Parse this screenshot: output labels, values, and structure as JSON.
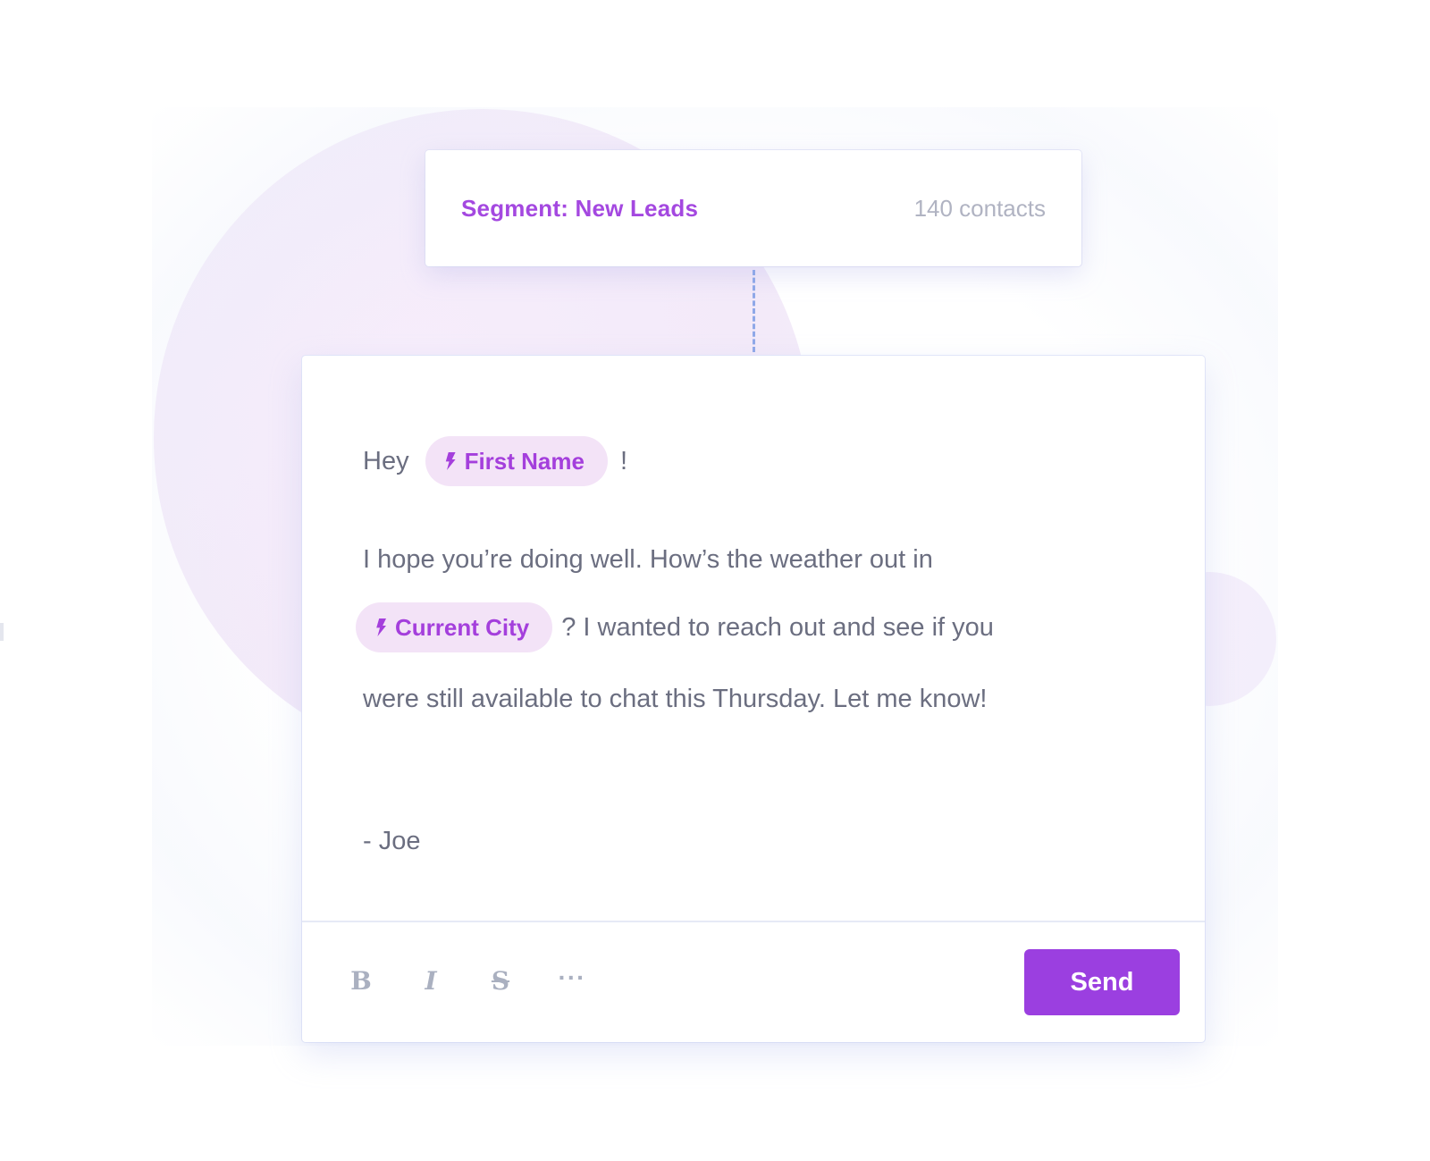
{
  "colors": {
    "accent": "#9b3fe0",
    "chip_bg": "#f3e3f7",
    "text": "#6b6e80",
    "muted": "#b0b3c2",
    "connector": "#8fa8e8"
  },
  "segment": {
    "label": "Segment: New Leads",
    "count": "140 contacts"
  },
  "message": {
    "greeting_prefix": "Hey",
    "first_name_tag": "First Name",
    "greeting_suffix": "!",
    "line1": "I hope you’re doing well. How’s the weather out in",
    "city_tag": "Current City",
    "line2_suffix": "? I wanted to reach out and see if you",
    "line3": "were still available to chat this Thursday. Let me know!",
    "signature": "- Joe"
  },
  "toolbar": {
    "bold_label": "B",
    "italic_label": "I",
    "strike_label": "S",
    "more_label": "···",
    "send_label": "Send",
    "icons": [
      "bold-icon",
      "italic-icon",
      "strikethrough-icon",
      "more-icon",
      "bolt-icon"
    ]
  }
}
